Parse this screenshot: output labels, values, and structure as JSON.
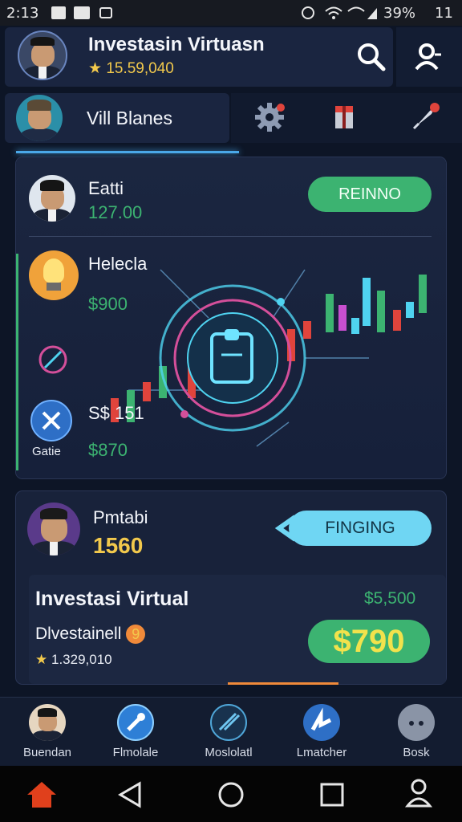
{
  "status_bar": {
    "time": "2:13",
    "battery": "39%",
    "extra": "11"
  },
  "header": {
    "title": "Investasin Virtuasn",
    "balance": "15.59,040",
    "star": "★"
  },
  "user_row": {
    "name": "Vill Blanes"
  },
  "card1": {
    "item1": {
      "name": "Eatti",
      "value": "127.00",
      "button": "REINNO"
    },
    "item2": {
      "name": "Helecla",
      "value": "$900"
    },
    "item3": {
      "name": "S$ 151",
      "value": "$870",
      "caption": "Gatie"
    }
  },
  "card2": {
    "name": "Pmtabi",
    "value": "1560",
    "button": "FINGING",
    "title": "Investasi Virtual",
    "right_value": "$5,500",
    "sub_label": "Dlvestainell",
    "sub_badge": "9",
    "sub_value": "1.329,010",
    "big_value": "$790"
  },
  "bottom_nav": {
    "items": [
      {
        "label": "Buendan"
      },
      {
        "label": "Flmolale"
      },
      {
        "label": "Moslolatl"
      },
      {
        "label": "Lmatcher"
      },
      {
        "label": "Bosk"
      }
    ]
  },
  "colors": {
    "accent_green": "#3cb371",
    "accent_cyan": "#6fd6f3",
    "gold": "#f2c94c",
    "background": "#0d1526"
  }
}
